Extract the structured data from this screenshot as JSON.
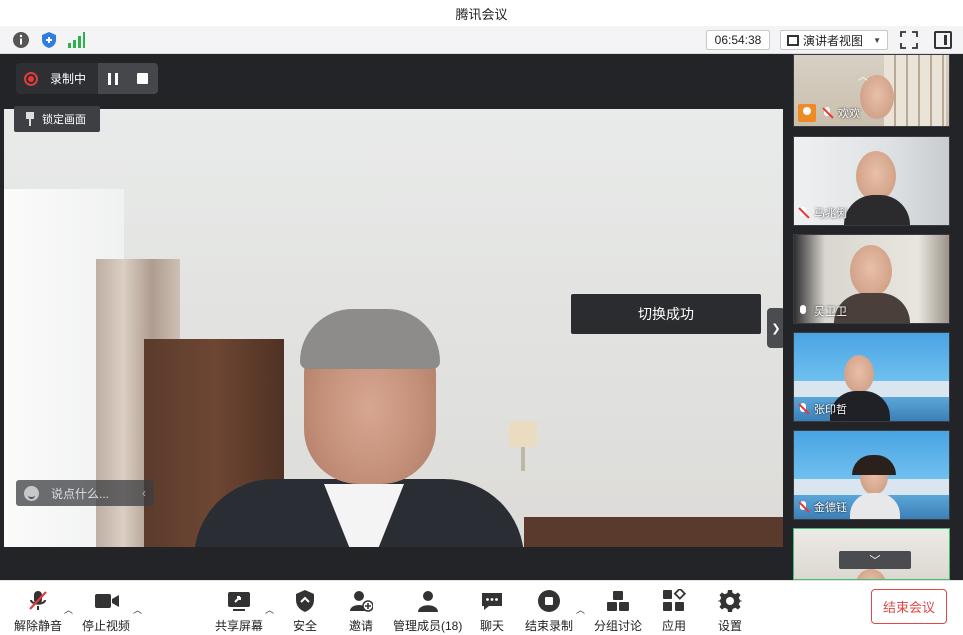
{
  "window": {
    "title": "腾讯会议"
  },
  "statusbar": {
    "timer": "06:54:38",
    "view_label": "演讲者视图",
    "icons": [
      "info-icon",
      "shield-icon",
      "signal-icon",
      "fullscreen-icon",
      "side-panel-icon"
    ]
  },
  "main": {
    "recording_label": "录制中",
    "lock_label": "锁定画面",
    "toast": "切换成功",
    "chat_placeholder": "说点什么..."
  },
  "participants": [
    {
      "name": "欢欢",
      "mic": "muted",
      "avatar": "orange"
    },
    {
      "name": "马兆俐",
      "mic": "muted"
    },
    {
      "name": "吴卫卫",
      "mic": "on"
    },
    {
      "name": "张印哲",
      "mic": "muted"
    },
    {
      "name": "金德钰",
      "mic": "muted"
    }
  ],
  "toolbar": {
    "unmute": "解除静音",
    "stop_video": "停止视频",
    "share_screen": "共享屏幕",
    "security": "安全",
    "invite": "邀请",
    "manage_members": "管理成员(18)",
    "chat": "聊天",
    "end_recording": "结束录制",
    "breakout": "分组讨论",
    "apps": "应用",
    "settings": "设置",
    "end_meeting": "结束会议"
  },
  "colors": {
    "accent_red": "#e04848",
    "panel_bg": "#232427",
    "shield_blue": "#2f7de1",
    "signal_green": "#2bb24c"
  }
}
